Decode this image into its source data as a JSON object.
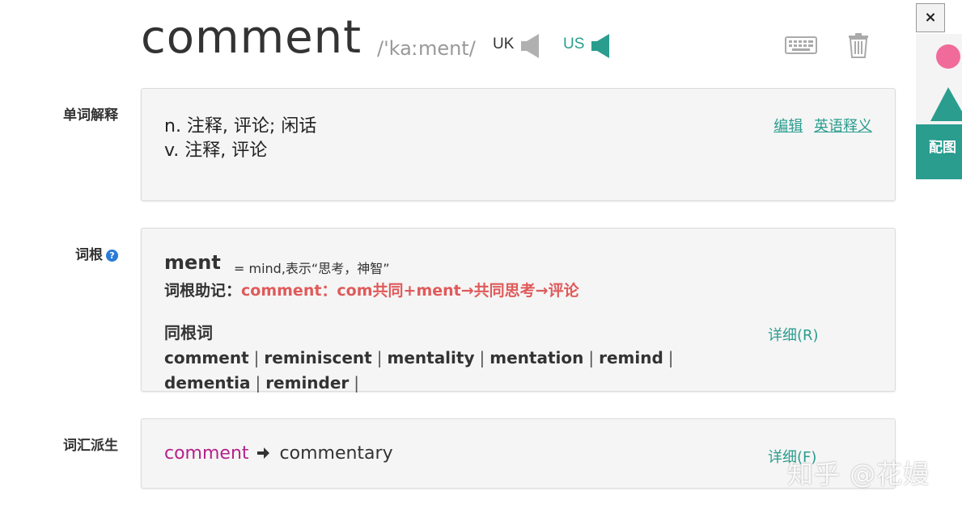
{
  "header": {
    "word": "comment",
    "phonetic": "/'kaːment/",
    "uk_label": "UK",
    "us_label": "US"
  },
  "sidebar_widgets": {
    "close": "×",
    "image_tab_label": "配图"
  },
  "definitions": {
    "section_label": "单词解释",
    "lines": [
      "n. 注释, 评论; 闲话",
      "v. 注释, 评论"
    ],
    "edit_link": "编辑",
    "english_def_link": "英语释义"
  },
  "root": {
    "section_label": "词根",
    "help_icon": "?",
    "root_word": "ment",
    "root_meaning": "= mind,表示“思考，神智”",
    "mnemonic_label": "词根助记：",
    "mnemonic_text": "comment：com共同+ment→共同思考→评论",
    "cognates_label": "同根词",
    "cognates": [
      "comment",
      "reminiscent",
      "mentality",
      "mentation",
      "remind",
      "dementia",
      "reminder"
    ],
    "separator": "|",
    "detail_link": "详细(R)"
  },
  "derivation": {
    "section_label": "词汇派生",
    "from": "comment",
    "to": "commentary",
    "detail_link": "详细(F)"
  },
  "watermark": "知乎 @花嫚",
  "colors": {
    "accent": "#2a9d8f",
    "mnemonic": "#e05a5a",
    "deriv_from": "#b5228b",
    "help": "#2b7bd8"
  },
  "icons": {
    "uk_speaker": "speaker-icon",
    "us_speaker": "speaker-icon",
    "keyboard": "keyboard-icon",
    "trash": "trash-icon"
  }
}
